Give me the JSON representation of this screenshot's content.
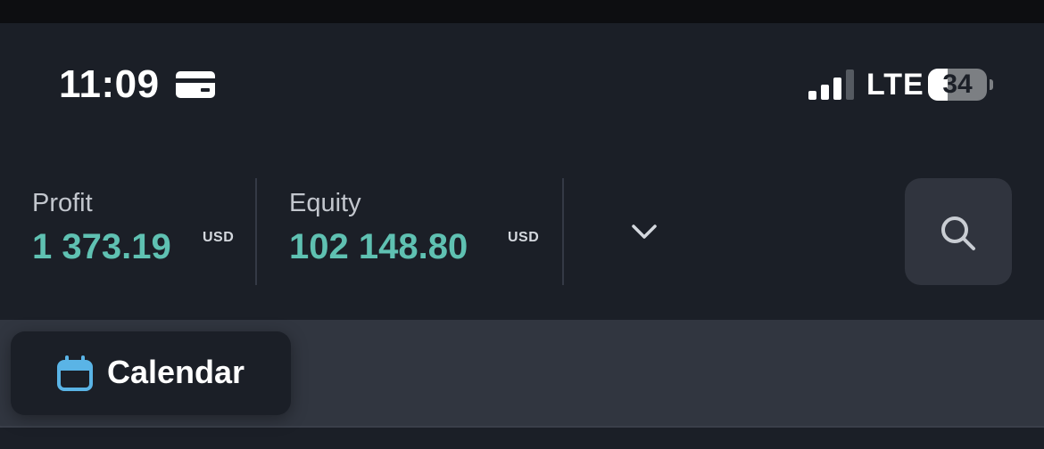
{
  "status_bar": {
    "time": "11:09",
    "network": "LTE",
    "battery_percent": "34",
    "battery_level": 0.34,
    "icons": [
      "card-icon",
      "signal-icon",
      "battery-icon"
    ]
  },
  "summary": {
    "profit": {
      "label": "Profit",
      "value": "1 373.19",
      "currency": "USD"
    },
    "equity": {
      "label": "Equity",
      "value": "102 148.80",
      "currency": "USD"
    },
    "expand_icon": "chevron-down-icon",
    "search_icon": "search-icon"
  },
  "toolbar": {
    "calendar_label": "Calendar",
    "calendar_icon": "calendar-icon"
  },
  "colors": {
    "background": "#1b1f27",
    "accent_value": "#5fc1b2",
    "strip": "#313640",
    "calendar_icon": "#5ab4e6"
  }
}
